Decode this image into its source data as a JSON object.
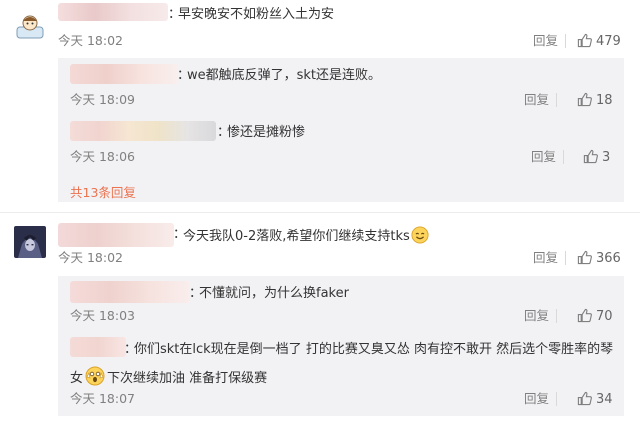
{
  "comments": [
    {
      "avatar_icon": "cartoon-pillow-avatar",
      "text": "早安晚安不如粉丝入土为安",
      "time": "今天 18:02",
      "reply_label": "回复",
      "like_count": "479",
      "replies": [
        {
          "text": "we都触底反弹了，skt还是连败。",
          "time": "今天 18:09",
          "reply_label": "回复",
          "like_count": "18"
        },
        {
          "text": "惨还是摊粉惨",
          "time": "今天 18:06",
          "reply_label": "回复",
          "like_count": "3"
        }
      ],
      "more_replies": "共13条回复"
    },
    {
      "avatar_icon": "dark-anime-avatar",
      "text": "今天我队0-2落败,希望你们继续支持tks",
      "emoji_icon": "smile-emoji",
      "time": "今天 18:02",
      "reply_label": "回复",
      "like_count": "366",
      "replies": [
        {
          "text": "不懂就问，为什么换faker",
          "time": "今天 18:03",
          "reply_label": "回复",
          "like_count": "70"
        },
        {
          "text_line1": "你们skt在lck现在是倒一档了 打的比赛又臭又怂 肉有控不敢开 然后选个零胜率的琴",
          "text_line2_prefix": "女",
          "emoji_icon": "scared-face-emoji",
          "text_line2_suffix": "下次继续加油 准备打保级赛",
          "time": "今天 18:07",
          "reply_label": "回复",
          "like_count": "34"
        }
      ]
    }
  ],
  "colors": {
    "more_link": "#eb7350",
    "meta": "#808080",
    "sub_bg": "#f2f2f5"
  }
}
